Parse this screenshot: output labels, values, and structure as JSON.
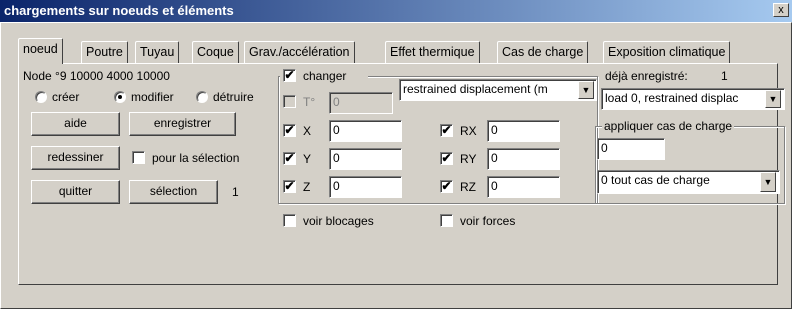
{
  "window": {
    "title": "chargements sur noeuds et éléments",
    "close_glyph": "x"
  },
  "tabs": [
    "noeud",
    "Poutre",
    "Tuyau",
    "Coque",
    "Grav./accélération",
    "Effet thermique",
    "Cas de charge",
    "Exposition climatique"
  ],
  "node_info": "Node °9  10000 4000 10000",
  "mode": {
    "options": [
      "créer",
      "modifier",
      "détruire"
    ],
    "selected": "modifier"
  },
  "buttons": {
    "help": "aide",
    "save": "enregistrer",
    "redraw": "redessiner",
    "quit": "quitter",
    "selection": "sélection"
  },
  "for_selection_label": "pour la sélection",
  "selection_count": "1",
  "change_group": {
    "label": "changer",
    "checked": true,
    "temperature_label": "T°",
    "temperature_value": "0",
    "type_select": "restrained displacement (m",
    "fields": [
      {
        "label": "X",
        "value": "0",
        "checked": true
      },
      {
        "label": "Y",
        "value": "0",
        "checked": true
      },
      {
        "label": "Z",
        "value": "0",
        "checked": true
      },
      {
        "label": "RX",
        "value": "0",
        "checked": true
      },
      {
        "label": "RY",
        "value": "0",
        "checked": true
      },
      {
        "label": "RZ",
        "value": "0",
        "checked": true
      }
    ]
  },
  "already_saved": {
    "label": "déjà enregistré:",
    "count": "1",
    "select_value": "load 0, restrained displac"
  },
  "apply_load_case": {
    "label": "appliquer cas de charge",
    "value": "0",
    "select_value": "0 tout cas de charge"
  },
  "options": {
    "show_blocks": "voir blocages",
    "show_forces": "voir forces"
  },
  "check_glyph": "✔"
}
